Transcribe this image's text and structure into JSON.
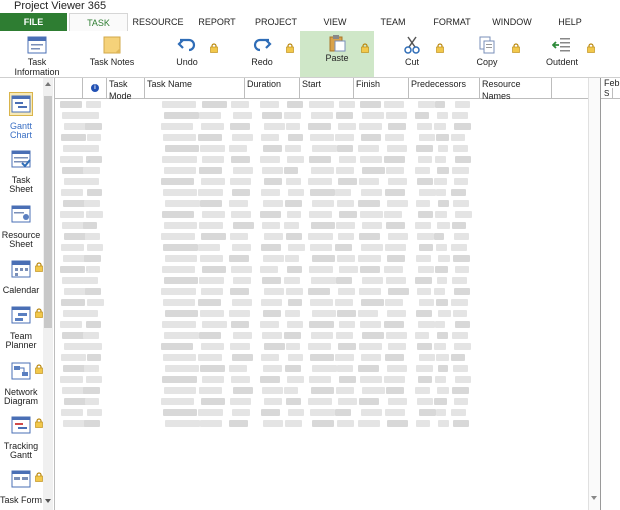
{
  "app": {
    "title": "Project Viewer 365"
  },
  "menu": {
    "items": [
      "FILE",
      "TASK",
      "RESOURCE",
      "REPORT",
      "PROJECT",
      "VIEW",
      "TEAM",
      "FORMAT",
      "WINDOW",
      "HELP"
    ]
  },
  "ribbon": {
    "task_information": "Task\nInformation",
    "task_notes": "Task Notes",
    "undo": "Undo",
    "redo": "Redo",
    "paste": "Paste",
    "cut": "Cut",
    "copy": "Copy",
    "outdent": "Outdent"
  },
  "sidebar": {
    "items": [
      "Gantt Chart",
      "Task Sheet",
      "Resource Sheet",
      "Calendar",
      "Team Planner",
      "Network Diagram",
      "Tracking Gantt",
      "Task Form"
    ]
  },
  "grid": {
    "columns": [
      "Task Mode",
      "Task Name",
      "Duration",
      "Start",
      "Finish",
      "Predecessors",
      "Resource Names"
    ]
  },
  "gantt": {
    "month": "Feb",
    "day": "S"
  },
  "colors": {
    "accent": "#2e7d32",
    "paste_bg": "#cfe7c8",
    "active_view": "#3a6fc4"
  }
}
